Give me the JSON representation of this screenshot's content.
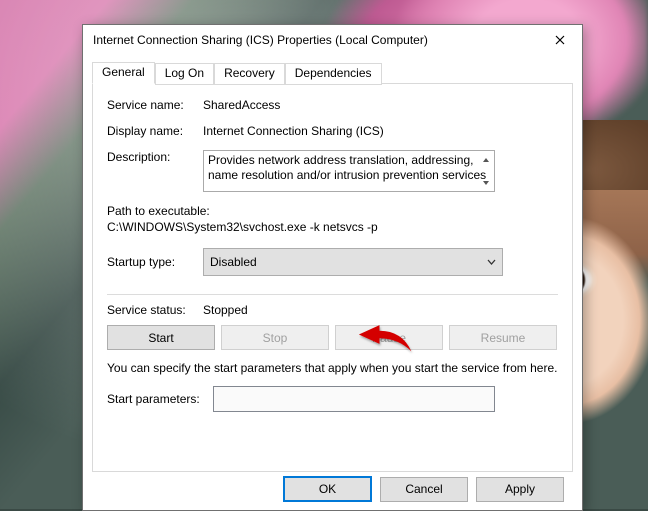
{
  "window": {
    "title": "Internet Connection Sharing (ICS) Properties (Local Computer)"
  },
  "tabs": {
    "general": "General",
    "logon": "Log On",
    "recovery": "Recovery",
    "dependencies": "Dependencies"
  },
  "labels": {
    "service_name": "Service name:",
    "display_name": "Display name:",
    "description": "Description:",
    "path_header": "Path to executable:",
    "startup_type": "Startup type:",
    "service_status": "Service status:",
    "start_parameters": "Start parameters:"
  },
  "values": {
    "service_name": "SharedAccess",
    "display_name": "Internet Connection Sharing (ICS)",
    "description": "Provides network address translation, addressing, name resolution and/or intrusion prevention services",
    "path": "C:\\WINDOWS\\System32\\svchost.exe -k netsvcs -p",
    "startup_type": "Disabled",
    "service_status": "Stopped",
    "start_parameters": ""
  },
  "buttons": {
    "start": "Start",
    "stop": "Stop",
    "pause": "Pause",
    "resume": "Resume",
    "ok": "OK",
    "cancel": "Cancel",
    "apply": "Apply"
  },
  "note": "You can specify the start parameters that apply when you start the service from here.",
  "colors": {
    "arrow": "#d40000"
  }
}
